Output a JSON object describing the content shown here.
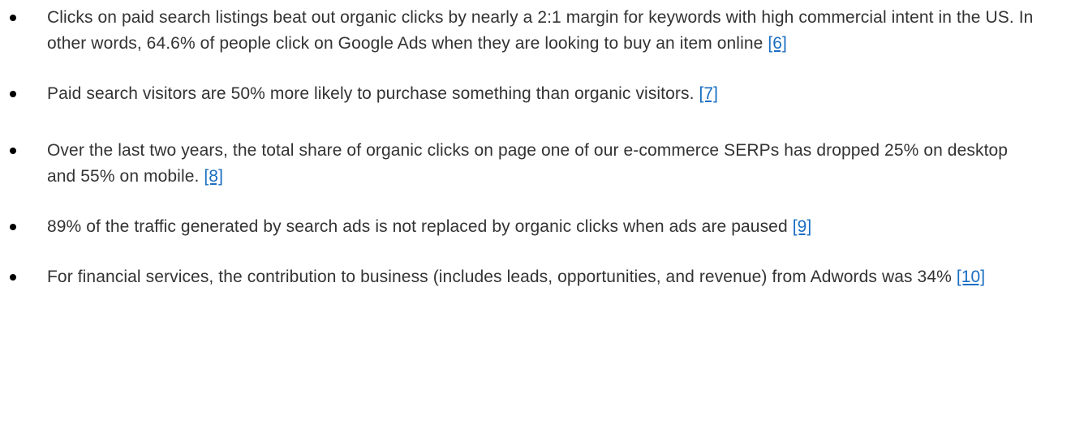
{
  "bullets": [
    {
      "text": "Clicks on paid search listings beat out organic clicks by nearly a 2:1 margin for keywords with high commercial intent in the US. In other words, 64.6% of people click on Google Ads when they are looking to buy an item online ",
      "ref": "[6]"
    },
    {
      "text": "Paid search visitors are 50% more likely to purchase something than organic visitors. ",
      "ref": "[7]"
    },
    {
      "text": "Over the last two years, the total share of organic clicks on page one of our e-commerce SERPs has dropped 25% on desktop and 55% on mobile. ",
      "ref": "[8]"
    },
    {
      "text": "89% of the traffic generated by search ads is not replaced by organic clicks when ads are paused ",
      "ref": "[9]"
    },
    {
      "text": "For financial services, the contribution to business (includes leads, opportunities, and revenue) from Adwords was 34% ",
      "ref": "[10]"
    }
  ],
  "colors": {
    "text": "#333333",
    "link": "#1a6ec2",
    "bullet": "#000000"
  }
}
